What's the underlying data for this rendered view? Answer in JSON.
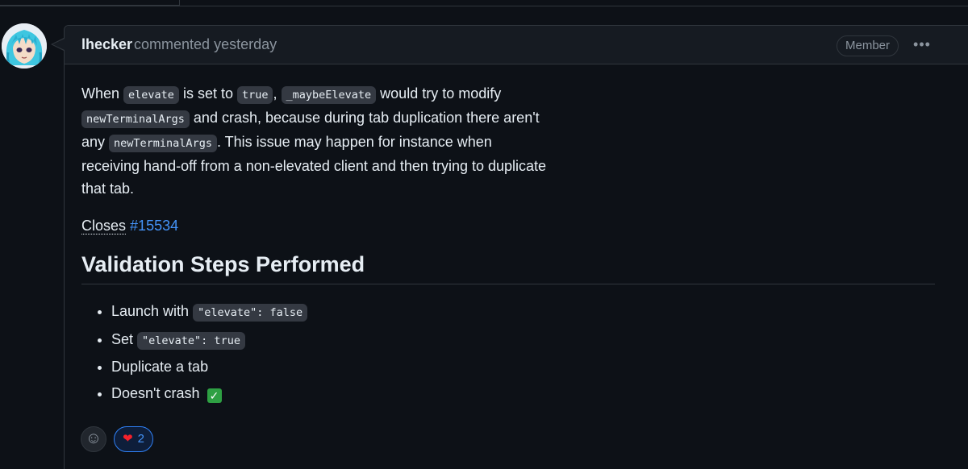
{
  "comment": {
    "author": "lhecker",
    "action": "commented",
    "timestamp": "yesterday",
    "badge": "Member",
    "menu_glyph": "•••"
  },
  "body": {
    "para": {
      "t1": "When ",
      "c1": "elevate",
      "t2": " is set to ",
      "c2": "true",
      "t3": ", ",
      "c3": "_maybeElevate",
      "t4": " would try to modify ",
      "c4": "newTerminalArgs",
      "t5": " and crash, because during tab duplication there aren't any ",
      "c5": "newTerminalArgs",
      "t6": ". This issue may happen for instance when receiving hand-off from a non-elevated client and then trying to duplicate that tab."
    },
    "closes_label": "Closes",
    "issue_ref": "#15534",
    "heading": "Validation Steps Performed",
    "steps": [
      {
        "text": "Launch with ",
        "code": "\"elevate\": false"
      },
      {
        "text": "Set ",
        "code": "\"elevate\": true"
      },
      {
        "text": "Duplicate a tab"
      },
      {
        "text": "Doesn't crash",
        "emoji_icon": "check-mark-button-icon"
      }
    ]
  },
  "reactions": {
    "add_icon": "smiley-icon",
    "heart": {
      "icon": "heart-icon",
      "count": "2"
    }
  },
  "colors": {
    "background": "#0d1117",
    "header": "#161b22",
    "border": "#30363d",
    "link": "#4493f8",
    "check": "#2ea043"
  }
}
